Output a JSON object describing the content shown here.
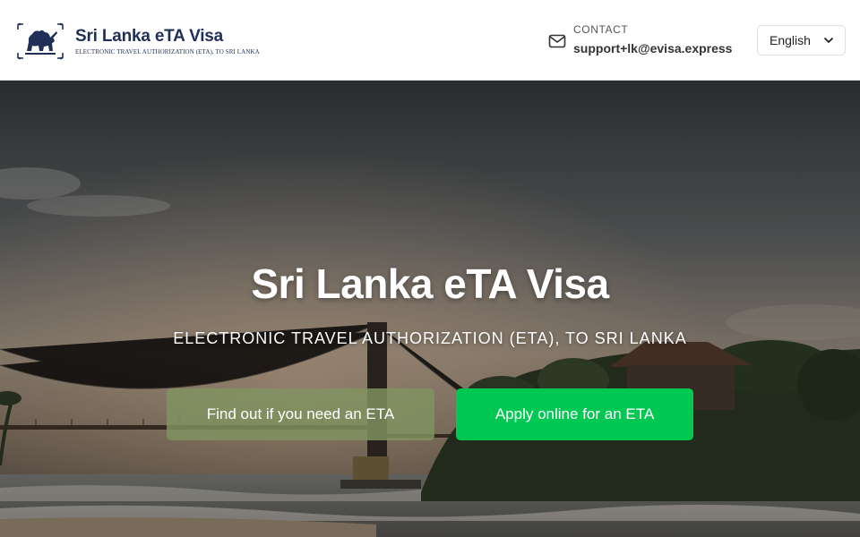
{
  "header": {
    "logo_title": "Sri Lanka eTA Visa",
    "logo_subtitle": "ELECTRONIC TRAVEL AUTHORIZATION (ETA), TO SRI LANKA",
    "contact_label": "CONTACT",
    "contact_email": "support+lk@evisa.express",
    "language": "English",
    "icons": [
      "sri-lanka-lion-emblem",
      "mail-icon",
      "chevron-down-icon"
    ]
  },
  "hero": {
    "title": "Sri Lanka eTA Visa",
    "subtitle": "ELECTRONIC TRAVEL AUTHORIZATION (ETA), TO SRI LANKA",
    "button_find": "Find out if you need an ETA",
    "button_apply": "Apply online for an ETA"
  },
  "colors": {
    "brand_navy": "#1f2f57",
    "primary_green": "#00c853",
    "secondary_olive": "#80945f"
  }
}
